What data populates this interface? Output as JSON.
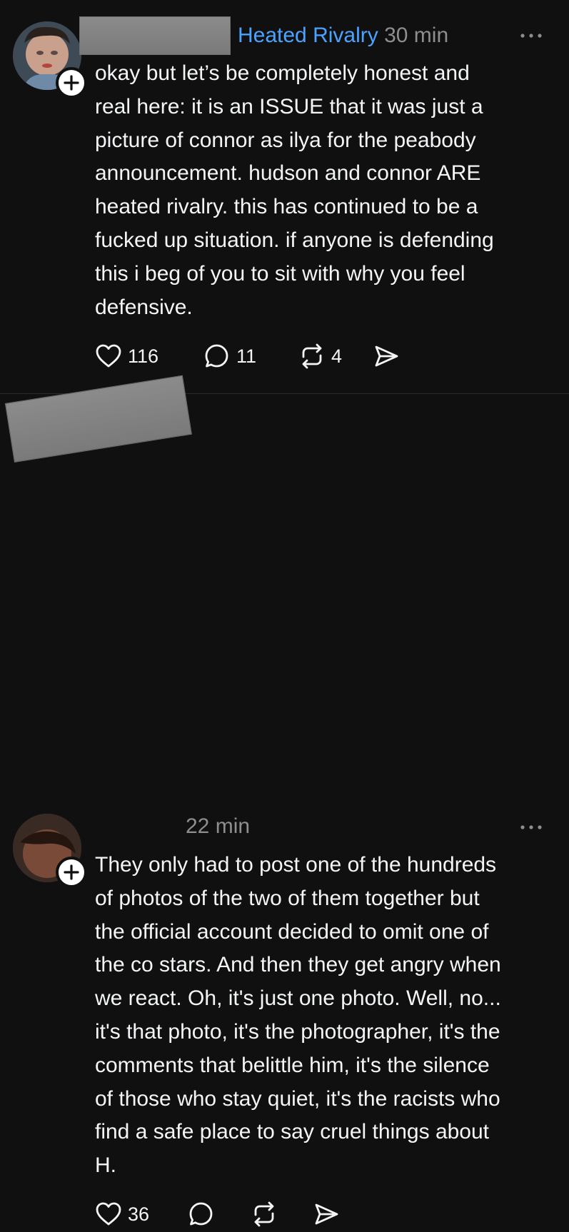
{
  "posts": [
    {
      "channel": "Heated Rivalry",
      "time": "30 min",
      "text": "okay but let’s be completely honest and\nreal here: it is an ISSUE that it was just a\npicture of connor as ilya for the peabody\nannouncement. hudson and connor ARE\nheated rivalry. this has continued to be a\nfucked up situation. if anyone is defending\nthis i beg of you to sit with why you feel\ndefensive.",
      "likes": "116",
      "replies": "11",
      "reposts": "4",
      "icons": [
        "heart-icon",
        "comment-icon",
        "repost-icon",
        "share-icon",
        "more-icon",
        "plus-icon"
      ]
    },
    {
      "time": "22 min",
      "text": "They only had to post one of the hundreds\nof photos of the two of them together but\nthe official account decided to omit one of\nthe co stars. And then they get angry when\nwe react. Oh, it's just one photo. Well, no...\nit's that photo, it's the photographer, it's the\ncomments that belittle him, it's the silence\nof those who stay quiet, it's the racists who\nfind a safe place to say cruel things about\nH.",
      "likes": "36",
      "icons": [
        "heart-icon",
        "comment-icon",
        "repost-icon",
        "share-icon",
        "more-icon",
        "plus-icon"
      ]
    }
  ],
  "colors": {
    "background": "#101010",
    "text": "#f3f5f7",
    "secondary": "#8e8e8e",
    "channel": "#4aa3ff",
    "divider": "#2a2a2a",
    "redaction": "#808080"
  }
}
